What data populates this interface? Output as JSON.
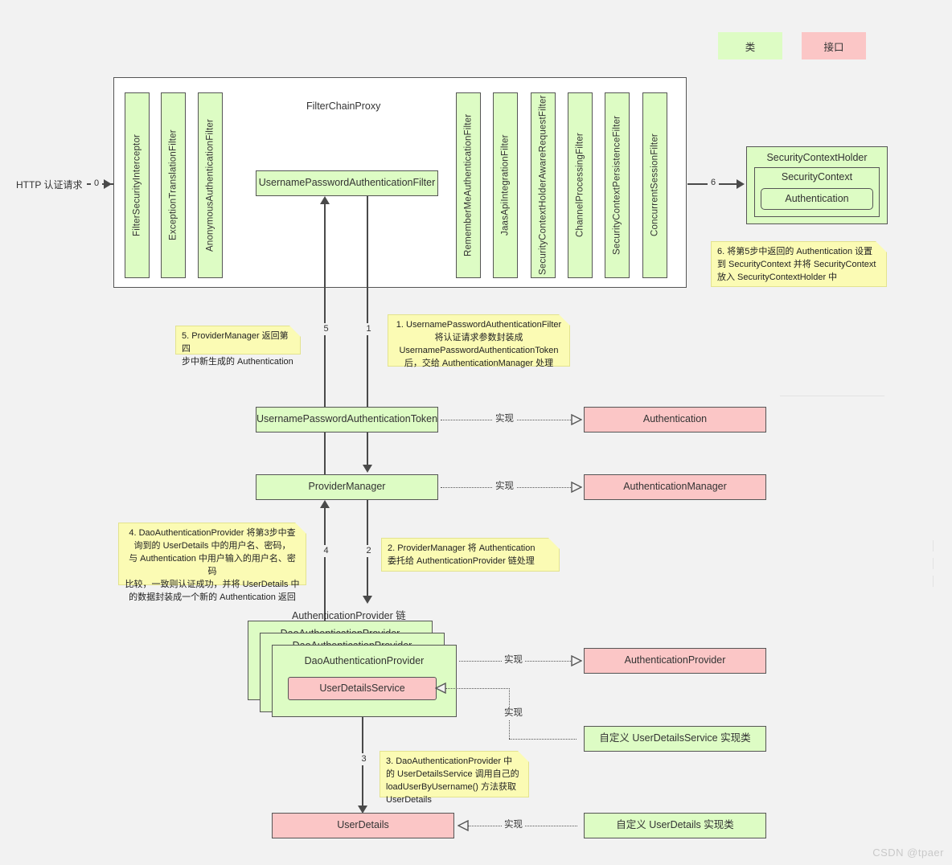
{
  "legend": {
    "class_label": "类",
    "interface_label": "接口",
    "class_color": "#ddfcc4",
    "interface_color": "#fbc6c6"
  },
  "entry": {
    "request_label": "HTTP 认证请求",
    "step": "0"
  },
  "filter_chain": {
    "title": "FilterChainProxy",
    "left_filters": [
      "FilterSecurityInterceptor",
      "ExceptionTranslationFilter",
      "AnonymousAuthenticationFilter"
    ],
    "right_filters": [
      "RememberMeAuthenticationFilter",
      "JaasApiIntegrationFilter",
      "SecurityContextHolderAwareRequestFilter",
      "ChannelProcessingFilter",
      "SecurityContextPersistenceFilter",
      "ConcurrentSessionFilter"
    ],
    "main_filter": "UsernamePasswordAuthenticationFilter"
  },
  "context_holder": {
    "outer": "SecurityContextHolder",
    "middle": "SecurityContext",
    "inner": "Authentication"
  },
  "nodes": {
    "token": "UsernamePasswordAuthenticationToken",
    "authentication": "Authentication",
    "provider_manager": "ProviderManager",
    "authentication_manager": "AuthenticationManager",
    "provider_chain_title": "AuthenticationProvider 链",
    "dao_provider": "DaoAuthenticationProvider",
    "user_details_service": "UserDetailsService",
    "authentication_provider": "AuthenticationProvider",
    "custom_uds": "自定义 UserDetailsService 实现类",
    "user_details": "UserDetails",
    "custom_user_details": "自定义 UserDetails 实现类"
  },
  "edges": {
    "realize": "实现",
    "step1": "1",
    "step2": "2",
    "step3": "3",
    "step4": "4",
    "step5": "5",
    "step6": "6"
  },
  "notes": {
    "n1": "1. UsernamePasswordAuthenticationFilter\n将认证请求参数封装成\nUsernamePasswordAuthenticationToken\n后，交给 AuthenticationManager 处理",
    "n2": "2. ProviderManager 将 Authentication\n委托给 AuthenticationProvider 链处理",
    "n3": "3. DaoAuthenticationProvider 中\n的 UserDetailsService 调用自己的\nloadUserByUsername() 方法获取\nUserDetails",
    "n4": "4. DaoAuthenticationProvider 将第3步中查\n询到的 UserDetails 中的用户名、密码，\n与 Authentication 中用户输入的用户名、密码\n比较，一致则认证成功，并将 UserDetails 中\n的数据封装成一个新的 Authentication 返回",
    "n5": "5. ProviderManager 返回第四\n步中新生成的 Authentication",
    "n6": "6. 将第5步中返回的 Authentication 设置\n到 SecurityContext 并将 SecurityContext\n放入 SecurityContextHolder 中"
  },
  "watermark": "CSDN @tpaer"
}
